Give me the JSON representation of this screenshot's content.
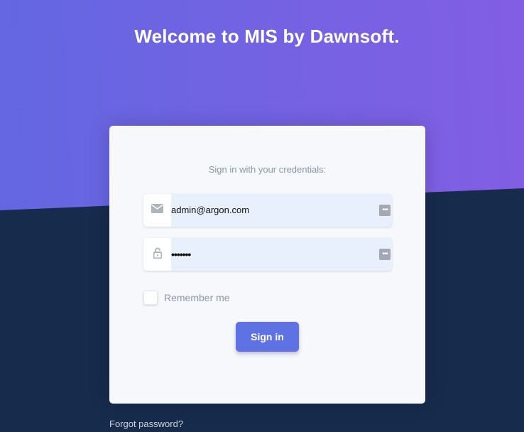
{
  "header": {
    "title": "Welcome to MIS by Dawnsoft."
  },
  "login": {
    "subtitle": "Sign in with your credentials:",
    "email": {
      "value": "admin@argon.com",
      "icon": "envelope-icon"
    },
    "password": {
      "value": "•••••••",
      "icon": "lock-icon"
    },
    "password_manager_icon": "key-icon",
    "remember_label": "Remember me",
    "signin_label": "Sign in"
  },
  "footer": {
    "forgot_label": "Forgot password?"
  },
  "colors": {
    "gradient_start": "#6367e1",
    "gradient_end": "#825ee4",
    "background": "#172b4d",
    "primary_button": "#5e72e4",
    "card": "#f6f8fb",
    "autofill": "#e8f0fe"
  }
}
